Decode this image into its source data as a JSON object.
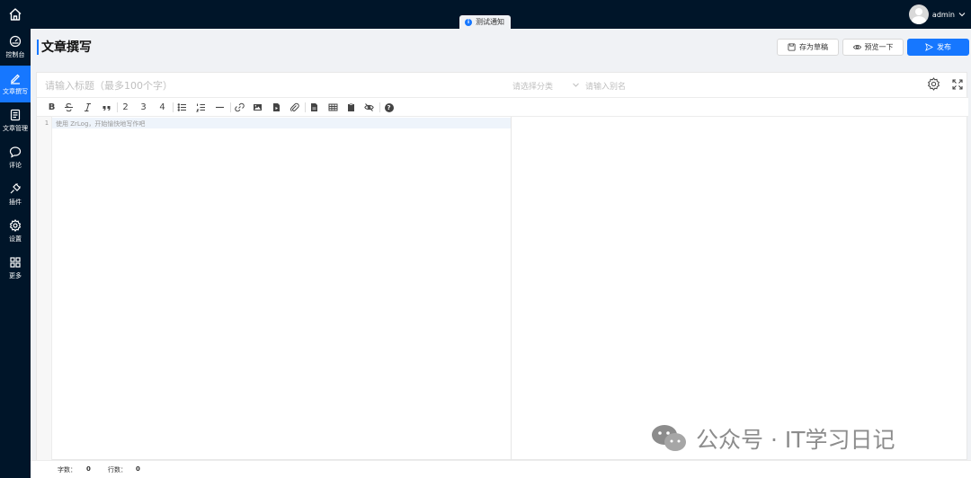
{
  "notice": {
    "text": "测试通知",
    "icon": "info-icon"
  },
  "user": {
    "name": "admin"
  },
  "sidebar": {
    "items": [
      {
        "label": "控制台",
        "icon": "dashboard-icon",
        "active": false
      },
      {
        "label": "文章撰写",
        "icon": "pen-icon",
        "active": true
      },
      {
        "label": "文章管理",
        "icon": "document-icon",
        "active": false
      },
      {
        "label": "评论",
        "icon": "comment-icon",
        "active": false
      },
      {
        "label": "插件",
        "icon": "plug-icon",
        "active": false
      },
      {
        "label": "设置",
        "icon": "gear-icon",
        "active": false
      },
      {
        "label": "更多",
        "icon": "grid-icon",
        "active": false
      }
    ]
  },
  "header": {
    "title": "文章撰写",
    "save_draft_label": "存为草稿",
    "preview_label": "预览一下",
    "publish_label": "发布"
  },
  "editor": {
    "title_placeholder": "请输入标题（最多100个字）",
    "category_placeholder": "请选择分类",
    "alias_placeholder": "请输入别名",
    "toolbar": {
      "bold": "B",
      "heading2": "2",
      "heading3": "3",
      "heading4": "4",
      "help": "?"
    },
    "line_number": "1",
    "content_placeholder": "使用 ZrLog，开始愉快地写作吧"
  },
  "footer": {
    "word_count_label": "字数：",
    "word_count": "0",
    "line_count_label": "行数：",
    "line_count": "0"
  },
  "watermark": {
    "text": "公众号 · IT学习日记"
  },
  "colors": {
    "dark": "#001529",
    "accent": "#1677ff",
    "background": "#f0f2f5"
  }
}
